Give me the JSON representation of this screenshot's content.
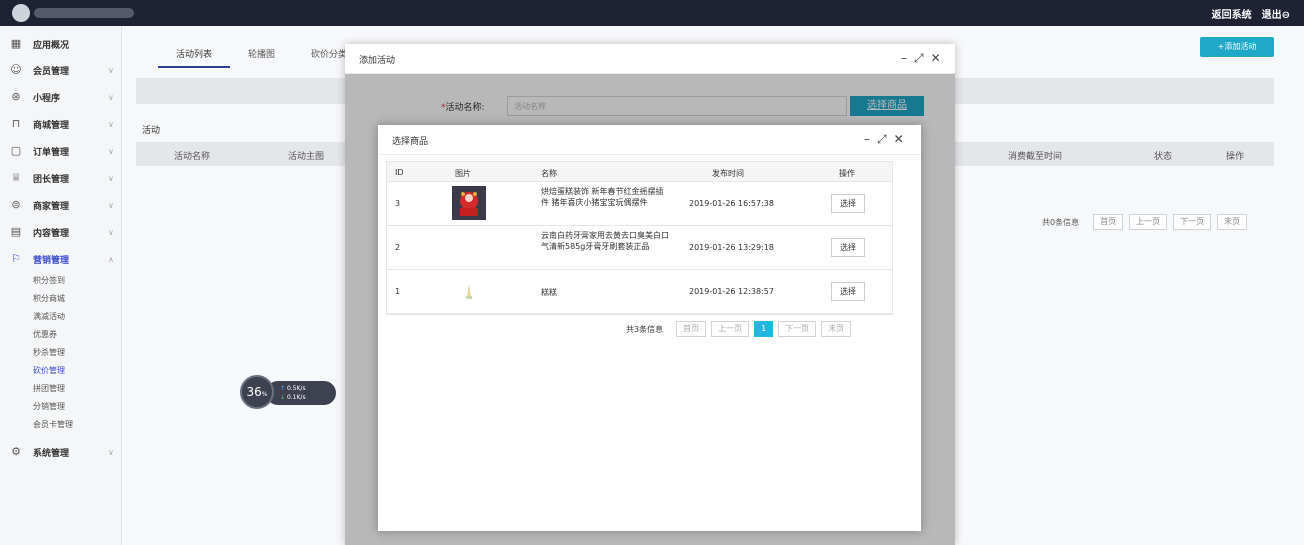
{
  "topbar": {
    "links": [
      "返回系统",
      "退出"
    ]
  },
  "sidebar": {
    "items": [
      {
        "label": "应用概况",
        "icon": "grid-icon"
      },
      {
        "label": "会员管理",
        "icon": "users-icon"
      },
      {
        "label": "小程序",
        "icon": "miniprogram-icon"
      },
      {
        "label": "商城管理",
        "icon": "cart-icon"
      },
      {
        "label": "订单管理",
        "icon": "order-icon"
      },
      {
        "label": "团长管理",
        "icon": "crown-icon"
      },
      {
        "label": "商家管理",
        "icon": "store-icon"
      },
      {
        "label": "内容管理",
        "icon": "content-icon"
      },
      {
        "label": "营销管理",
        "icon": "marketing-icon"
      }
    ],
    "sub_items": [
      "积分签到",
      "积分商城",
      "满减活动",
      "优惠券",
      "秒杀管理",
      "砍价管理",
      "拼团管理",
      "分销管理",
      "会员卡管理"
    ],
    "settings": {
      "label": "系统管理",
      "icon": "settings-icon"
    }
  },
  "main": {
    "tabs": [
      "活动列表",
      "轮播图",
      "砍价分类"
    ],
    "add_button": "+添加活动",
    "section_label": "活动",
    "columns": [
      "活动名称",
      "活动主图",
      "消费截至时间",
      "状态",
      "操作"
    ],
    "pager": {
      "total": "共0条信息",
      "buttons": [
        "首页",
        "上一页",
        "下一页",
        "末页"
      ]
    }
  },
  "speed_widget": {
    "percent": "36",
    "unit": "%",
    "up": "0.5K/s",
    "down": "0.1K/s"
  },
  "add_modal": {
    "title": "添加活动",
    "name_label": "活动名称:",
    "name_placeholder": "活动名称",
    "select_button": "选择商品"
  },
  "goods_modal": {
    "title": "选择商品",
    "columns": [
      "ID",
      "图片",
      "名称",
      "发布时间",
      "操作"
    ],
    "rows": [
      {
        "id": "3",
        "name": "烘焙蛋糕装饰 新年春节红金摇摆插件 猪年喜庆小猪宝宝玩偶摆件",
        "time": "2019-01-26 16:57:38",
        "action": "选择"
      },
      {
        "id": "2",
        "name": "云南白药牙膏家用去黄去口臭美白口气清新585g牙膏牙刷套装正品",
        "time": "2019-01-26 13:29:18",
        "action": "选择"
      },
      {
        "id": "1",
        "name": "糕糕",
        "time": "2019-01-26 12:38:57",
        "action": "选择"
      }
    ],
    "pager": {
      "total": "共3条信息",
      "first": "首页",
      "prev": "上一页",
      "current": "1",
      "next": "下一页",
      "last": "末页"
    }
  },
  "colors": {
    "accent": "#20a8c8",
    "topbar": "#1e2233",
    "active_nav": "#3a4bd1"
  }
}
